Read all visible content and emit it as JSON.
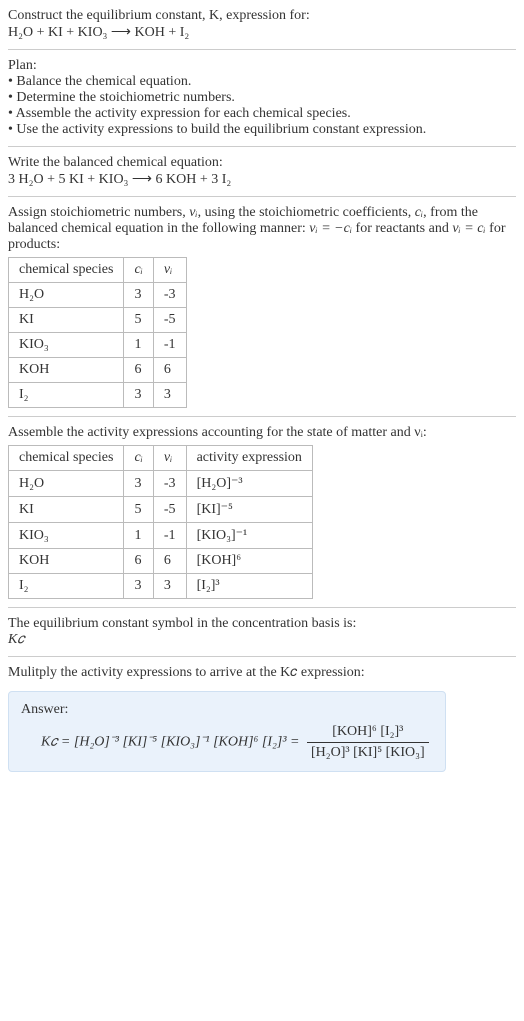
{
  "title_line1": "Construct the equilibrium constant, K, expression for:",
  "title_eq": "H₂O + KI + KIO₃  ⟶  KOH + I₂",
  "plan_heading": "Plan:",
  "plan_items": [
    "• Balance the chemical equation.",
    "• Determine the stoichiometric numbers.",
    "• Assemble the activity expression for each chemical species.",
    "• Use the activity expressions to build the equilibrium constant expression."
  ],
  "balanced_heading": "Write the balanced chemical equation:",
  "balanced_eq": "3 H₂O + 5 KI + KIO₃  ⟶  6 KOH + 3 I₂",
  "stoich_text_a": "Assign stoichiometric numbers, ",
  "stoich_text_b": ", using the stoichiometric coefficients, ",
  "stoich_text_c": ", from the balanced chemical equation in the following manner: ",
  "stoich_text_d": " for reactants and ",
  "stoich_text_e": " for products:",
  "nu_sym": "νᵢ",
  "c_sym": "cᵢ",
  "rel_reactants": "νᵢ = −cᵢ",
  "rel_products": "νᵢ = cᵢ",
  "table1": {
    "headers": [
      "chemical species",
      "cᵢ",
      "νᵢ"
    ],
    "rows": [
      [
        "H₂O",
        "3",
        "-3"
      ],
      [
        "KI",
        "5",
        "-5"
      ],
      [
        "KIO₃",
        "1",
        "-1"
      ],
      [
        "KOH",
        "6",
        "6"
      ],
      [
        "I₂",
        "3",
        "3"
      ]
    ]
  },
  "activity_heading": "Assemble the activity expressions accounting for the state of matter and νᵢ:",
  "table2": {
    "headers": [
      "chemical species",
      "cᵢ",
      "νᵢ",
      "activity expression"
    ],
    "rows": [
      [
        "H₂O",
        "3",
        "-3",
        "[H₂O]⁻³"
      ],
      [
        "KI",
        "5",
        "-5",
        "[KI]⁻⁵"
      ],
      [
        "KIO₃",
        "1",
        "-1",
        "[KIO₃]⁻¹"
      ],
      [
        "KOH",
        "6",
        "6",
        "[KOH]⁶"
      ],
      [
        "I₂",
        "3",
        "3",
        "[I₂]³"
      ]
    ]
  },
  "symbol_line1": "The equilibrium constant symbol in the concentration basis is:",
  "symbol_line2": "K𝑐",
  "multiply_line": "Mulitply the activity expressions to arrive at the K𝑐 expression:",
  "answer_label": "Answer:",
  "answer_lhs": "K𝑐 = [H₂O]⁻³ [KI]⁻⁵ [KIO₃]⁻¹ [KOH]⁶ [I₂]³ = ",
  "answer_num": "[KOH]⁶ [I₂]³",
  "answer_den": "[H₂O]³ [KI]⁵ [KIO₃]",
  "chart_data": {
    "type": "table",
    "title": "Stoichiometric numbers and activity expressions",
    "tables": [
      {
        "columns": [
          "chemical species",
          "c_i",
          "nu_i"
        ],
        "rows": [
          {
            "chemical species": "H2O",
            "c_i": 3,
            "nu_i": -3
          },
          {
            "chemical species": "KI",
            "c_i": 5,
            "nu_i": -5
          },
          {
            "chemical species": "KIO3",
            "c_i": 1,
            "nu_i": -1
          },
          {
            "chemical species": "KOH",
            "c_i": 6,
            "nu_i": 6
          },
          {
            "chemical species": "I2",
            "c_i": 3,
            "nu_i": 3
          }
        ]
      },
      {
        "columns": [
          "chemical species",
          "c_i",
          "nu_i",
          "activity expression"
        ],
        "rows": [
          {
            "chemical species": "H2O",
            "c_i": 3,
            "nu_i": -3,
            "activity expression": "[H2O]^-3"
          },
          {
            "chemical species": "KI",
            "c_i": 5,
            "nu_i": -5,
            "activity expression": "[KI]^-5"
          },
          {
            "chemical species": "KIO3",
            "c_i": 1,
            "nu_i": -1,
            "activity expression": "[KIO3]^-1"
          },
          {
            "chemical species": "KOH",
            "c_i": 6,
            "nu_i": 6,
            "activity expression": "[KOH]^6"
          },
          {
            "chemical species": "I2",
            "c_i": 3,
            "nu_i": 3,
            "activity expression": "[I2]^3"
          }
        ]
      }
    ]
  }
}
